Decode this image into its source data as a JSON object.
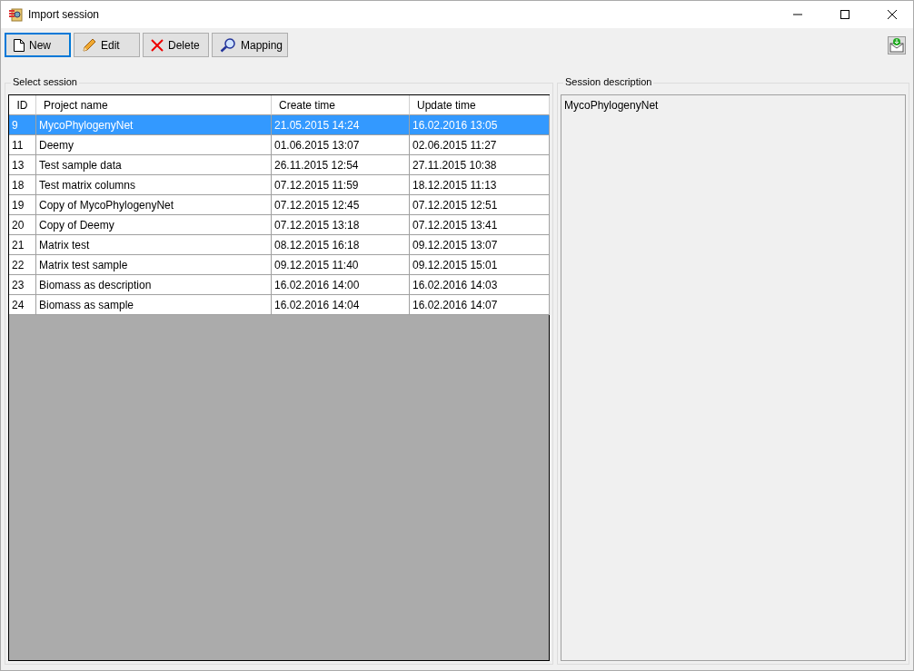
{
  "window": {
    "title": "Import session"
  },
  "toolbar": [
    {
      "kind": "new",
      "label": "New",
      "focused": true
    },
    {
      "kind": "edit",
      "label": "Edit",
      "focused": false
    },
    {
      "kind": "delete",
      "label": "Delete",
      "focused": false
    },
    {
      "kind": "mapping",
      "label": "Mapping",
      "focused": false
    }
  ],
  "select_session": {
    "title": "Select session",
    "columns": [
      "ID",
      "Project name",
      "Create time",
      "Update time"
    ],
    "rows": [
      {
        "cells": [
          "9",
          "MycoPhylogenyNet",
          "21.05.2015 14:24",
          "16.02.2016 13:05"
        ],
        "selected": true
      },
      {
        "cells": [
          "11",
          "Deemy",
          "01.06.2015 13:07",
          "02.06.2015 11:27"
        ],
        "selected": false
      },
      {
        "cells": [
          "13",
          "Test sample data",
          "26.11.2015 12:54",
          "27.11.2015 10:38"
        ],
        "selected": false
      },
      {
        "cells": [
          "18",
          "Test matrix columns",
          "07.12.2015 11:59",
          "18.12.2015 11:13"
        ],
        "selected": false
      },
      {
        "cells": [
          "19",
          "Copy of MycoPhylogenyNet",
          "07.12.2015 12:45",
          "07.12.2015 12:51"
        ],
        "selected": false
      },
      {
        "cells": [
          "20",
          "Copy of Deemy",
          "07.12.2015 13:18",
          "07.12.2015 13:41"
        ],
        "selected": false
      },
      {
        "cells": [
          "21",
          "Matrix test",
          "08.12.2015 16:18",
          "09.12.2015 13:07"
        ],
        "selected": false
      },
      {
        "cells": [
          "22",
          "Matrix test sample",
          "09.12.2015 11:40",
          "09.12.2015 15:01"
        ],
        "selected": false
      },
      {
        "cells": [
          "23",
          "Biomass as description",
          "16.02.2016 14:00",
          "16.02.2016 14:03"
        ],
        "selected": false
      },
      {
        "cells": [
          "24",
          "Biomass as sample",
          "16.02.2016 14:04",
          "16.02.2016 14:07"
        ],
        "selected": false
      }
    ]
  },
  "session_description": {
    "title": "Session description",
    "value": "MycoPhylogenyNet"
  }
}
